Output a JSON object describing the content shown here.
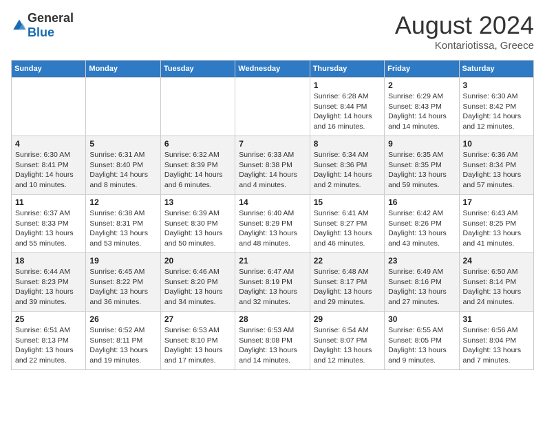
{
  "logo": {
    "general": "General",
    "blue": "Blue"
  },
  "title": "August 2024",
  "location": "Kontariotissa, Greece",
  "days_header": [
    "Sunday",
    "Monday",
    "Tuesday",
    "Wednesday",
    "Thursday",
    "Friday",
    "Saturday"
  ],
  "weeks": [
    [
      {
        "day": "",
        "info": ""
      },
      {
        "day": "",
        "info": ""
      },
      {
        "day": "",
        "info": ""
      },
      {
        "day": "",
        "info": ""
      },
      {
        "day": "1",
        "info": "Sunrise: 6:28 AM\nSunset: 8:44 PM\nDaylight: 14 hours and 16 minutes."
      },
      {
        "day": "2",
        "info": "Sunrise: 6:29 AM\nSunset: 8:43 PM\nDaylight: 14 hours and 14 minutes."
      },
      {
        "day": "3",
        "info": "Sunrise: 6:30 AM\nSunset: 8:42 PM\nDaylight: 14 hours and 12 minutes."
      }
    ],
    [
      {
        "day": "4",
        "info": "Sunrise: 6:30 AM\nSunset: 8:41 PM\nDaylight: 14 hours and 10 minutes."
      },
      {
        "day": "5",
        "info": "Sunrise: 6:31 AM\nSunset: 8:40 PM\nDaylight: 14 hours and 8 minutes."
      },
      {
        "day": "6",
        "info": "Sunrise: 6:32 AM\nSunset: 8:39 PM\nDaylight: 14 hours and 6 minutes."
      },
      {
        "day": "7",
        "info": "Sunrise: 6:33 AM\nSunset: 8:38 PM\nDaylight: 14 hours and 4 minutes."
      },
      {
        "day": "8",
        "info": "Sunrise: 6:34 AM\nSunset: 8:36 PM\nDaylight: 14 hours and 2 minutes."
      },
      {
        "day": "9",
        "info": "Sunrise: 6:35 AM\nSunset: 8:35 PM\nDaylight: 13 hours and 59 minutes."
      },
      {
        "day": "10",
        "info": "Sunrise: 6:36 AM\nSunset: 8:34 PM\nDaylight: 13 hours and 57 minutes."
      }
    ],
    [
      {
        "day": "11",
        "info": "Sunrise: 6:37 AM\nSunset: 8:33 PM\nDaylight: 13 hours and 55 minutes."
      },
      {
        "day": "12",
        "info": "Sunrise: 6:38 AM\nSunset: 8:31 PM\nDaylight: 13 hours and 53 minutes."
      },
      {
        "day": "13",
        "info": "Sunrise: 6:39 AM\nSunset: 8:30 PM\nDaylight: 13 hours and 50 minutes."
      },
      {
        "day": "14",
        "info": "Sunrise: 6:40 AM\nSunset: 8:29 PM\nDaylight: 13 hours and 48 minutes."
      },
      {
        "day": "15",
        "info": "Sunrise: 6:41 AM\nSunset: 8:27 PM\nDaylight: 13 hours and 46 minutes."
      },
      {
        "day": "16",
        "info": "Sunrise: 6:42 AM\nSunset: 8:26 PM\nDaylight: 13 hours and 43 minutes."
      },
      {
        "day": "17",
        "info": "Sunrise: 6:43 AM\nSunset: 8:25 PM\nDaylight: 13 hours and 41 minutes."
      }
    ],
    [
      {
        "day": "18",
        "info": "Sunrise: 6:44 AM\nSunset: 8:23 PM\nDaylight: 13 hours and 39 minutes."
      },
      {
        "day": "19",
        "info": "Sunrise: 6:45 AM\nSunset: 8:22 PM\nDaylight: 13 hours and 36 minutes."
      },
      {
        "day": "20",
        "info": "Sunrise: 6:46 AM\nSunset: 8:20 PM\nDaylight: 13 hours and 34 minutes."
      },
      {
        "day": "21",
        "info": "Sunrise: 6:47 AM\nSunset: 8:19 PM\nDaylight: 13 hours and 32 minutes."
      },
      {
        "day": "22",
        "info": "Sunrise: 6:48 AM\nSunset: 8:17 PM\nDaylight: 13 hours and 29 minutes."
      },
      {
        "day": "23",
        "info": "Sunrise: 6:49 AM\nSunset: 8:16 PM\nDaylight: 13 hours and 27 minutes."
      },
      {
        "day": "24",
        "info": "Sunrise: 6:50 AM\nSunset: 8:14 PM\nDaylight: 13 hours and 24 minutes."
      }
    ],
    [
      {
        "day": "25",
        "info": "Sunrise: 6:51 AM\nSunset: 8:13 PM\nDaylight: 13 hours and 22 minutes."
      },
      {
        "day": "26",
        "info": "Sunrise: 6:52 AM\nSunset: 8:11 PM\nDaylight: 13 hours and 19 minutes."
      },
      {
        "day": "27",
        "info": "Sunrise: 6:53 AM\nSunset: 8:10 PM\nDaylight: 13 hours and 17 minutes."
      },
      {
        "day": "28",
        "info": "Sunrise: 6:53 AM\nSunset: 8:08 PM\nDaylight: 13 hours and 14 minutes."
      },
      {
        "day": "29",
        "info": "Sunrise: 6:54 AM\nSunset: 8:07 PM\nDaylight: 13 hours and 12 minutes."
      },
      {
        "day": "30",
        "info": "Sunrise: 6:55 AM\nSunset: 8:05 PM\nDaylight: 13 hours and 9 minutes."
      },
      {
        "day": "31",
        "info": "Sunrise: 6:56 AM\nSunset: 8:04 PM\nDaylight: 13 hours and 7 minutes."
      }
    ]
  ]
}
